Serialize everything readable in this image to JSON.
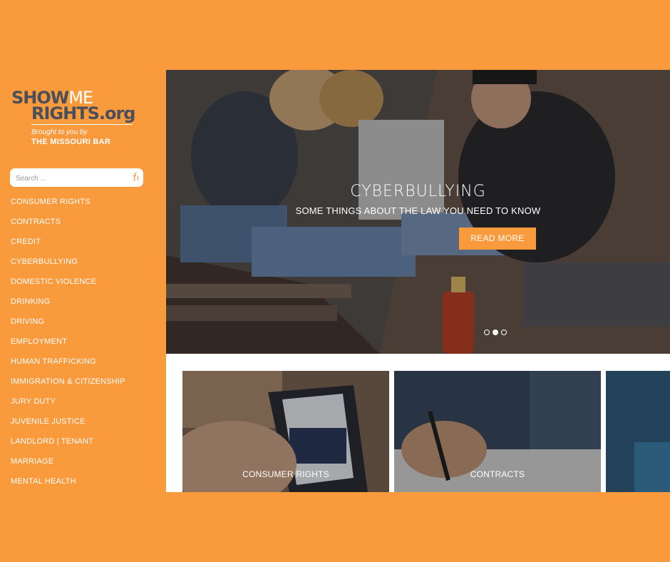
{
  "logo": {
    "word_show": "SHOW",
    "word_me": "ME",
    "word_rights": "RIGHTS.org",
    "tagline": "Brought to you by",
    "org": "THE MISSOURI BAR"
  },
  "search": {
    "placeholder": "Search ...",
    "icon": "search-icon"
  },
  "nav": {
    "items": [
      "CONSUMER RIGHTS",
      "CONTRACTS",
      "CREDIT",
      "CYBERBULLYING",
      "DOMESTIC VIOLENCE",
      "DRINKING",
      "DRIVING",
      "EMPLOYMENT",
      "HUMAN TRAFFICKING",
      "IMMIGRATION & CITIZENSHIP",
      "JURY DUTY",
      "JUVENILE JUSTICE",
      "LANDLORD | TENANT",
      "MARRIAGE",
      "MENTAL HEALTH"
    ]
  },
  "hero": {
    "title": "CYBERBULLYING",
    "subtitle": "SOME THINGS ABOUT THE LAW YOU NEED TO KNOW",
    "button": "READ MORE",
    "slides": 3,
    "active_slide": 2
  },
  "cards": [
    {
      "label": "CONSUMER RIGHTS"
    },
    {
      "label": "CONTRACTS"
    },
    {
      "label": ""
    }
  ],
  "colors": {
    "brand_orange": "#f99a3d",
    "logo_gray": "#4a4f5a",
    "white": "#ffffff"
  }
}
